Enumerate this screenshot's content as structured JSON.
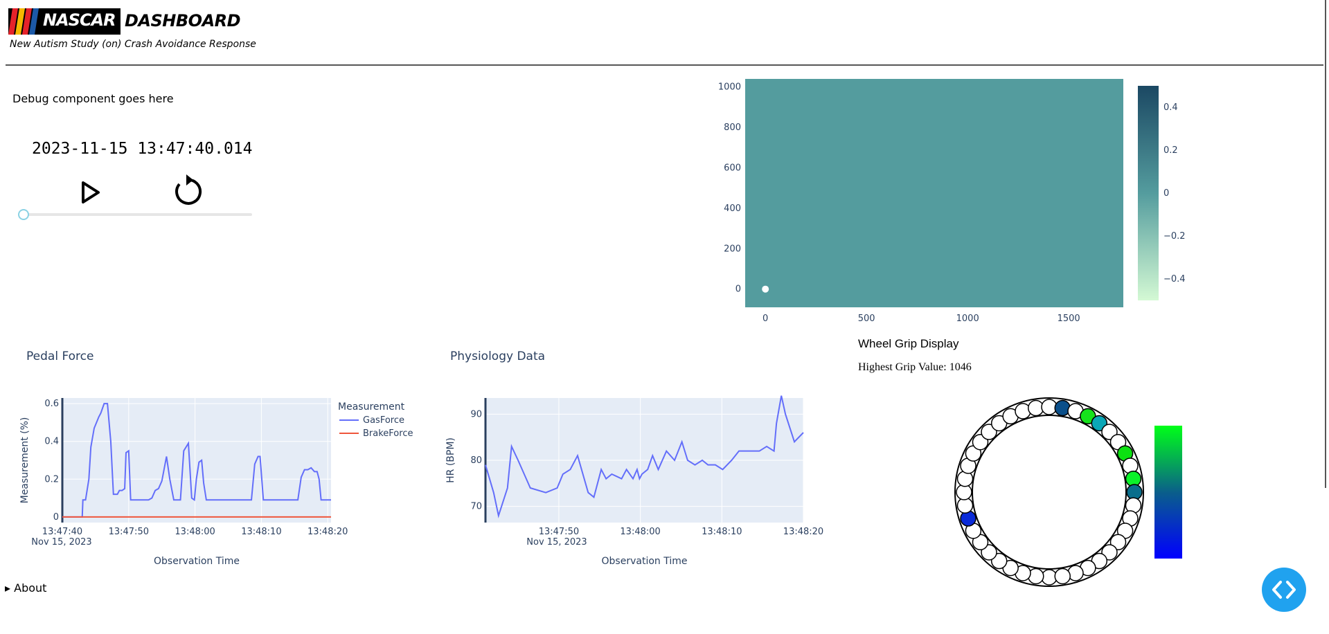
{
  "header": {
    "logo_text": "NASCAR",
    "title": "DASHBOARD",
    "subtitle": "New Autism Study (on) Crash Avoidance Response"
  },
  "debug": {
    "text": "Debug component goes here",
    "timestamp": "2023-11-15 13:47:40.014",
    "play_icon": "play-icon",
    "reset_icon": "reset-icon",
    "slider_value": 0
  },
  "colors": {
    "heatmap_fill": "#549c9e",
    "colorscale_top": "#1b4863",
    "colorscale_bottom": "#d4f9d4",
    "gas": "#636efa",
    "brake": "#ef553b",
    "plot_bg": "#e5ecf6",
    "accent": "#20a2ef"
  },
  "heatmap": {
    "chart_data": {
      "type": "heatmap",
      "x_ticks": [
        "0",
        "500",
        "1000",
        "1500"
      ],
      "y_ticks": [
        "0",
        "200",
        "400",
        "600",
        "800",
        "1000"
      ],
      "xlim": [
        -100,
        1770
      ],
      "ylim": [
        -90,
        1040
      ],
      "fill_value": 0,
      "marker": {
        "x": 0,
        "y": 0
      },
      "colorbar_ticks": [
        "0.4",
        "0.2",
        "0",
        "−0.2",
        "−0.4"
      ],
      "colorbar_range": [
        -0.5,
        0.5
      ]
    }
  },
  "pedal": {
    "title": "Pedal Force",
    "chart_data": {
      "type": "line",
      "xlabel": "Observation Time",
      "ylabel": "Measurement (%)",
      "x_ticks": [
        "13:47:40",
        "13:47:50",
        "13:48:00",
        "13:48:10",
        "13:48:20"
      ],
      "date_label": "Nov 15, 2023",
      "y_ticks": [
        "0",
        "0.2",
        "0.4",
        "0.6"
      ],
      "xlim": [
        0,
        40.5
      ],
      "ylim": [
        -0.03,
        0.63
      ],
      "legend_title": "Measurement",
      "series": [
        {
          "name": "GasForce",
          "x": [
            0,
            3.0,
            3.1,
            3.5,
            4.0,
            4.3,
            4.8,
            5.5,
            5.8,
            6.3,
            6.8,
            7.3,
            7.7,
            8.0,
            8.3,
            8.6,
            9.0,
            9.4,
            9.6,
            10.0,
            10.3,
            10.6,
            10.9,
            11.3,
            13.0,
            13.5,
            14.0,
            14.5,
            15.0,
            15.7,
            16.2,
            16.8,
            17.3,
            17.8,
            18.3,
            19.0,
            19.5,
            19.9,
            20.2,
            20.6,
            21.0,
            21.3,
            21.7,
            23.0,
            28.5,
            29.0,
            29.5,
            29.8,
            30.3,
            35.5,
            36.0,
            36.5,
            37.0,
            37.5,
            38.0,
            38.4,
            38.7,
            39.0,
            40.5
          ],
          "values": [
            0,
            0,
            0.09,
            0.09,
            0.2,
            0.37,
            0.47,
            0.53,
            0.55,
            0.6,
            0.6,
            0.4,
            0.12,
            0.12,
            0.12,
            0.14,
            0.14,
            0.15,
            0.34,
            0.35,
            0.09,
            0.09,
            0.09,
            0.09,
            0.09,
            0.1,
            0.14,
            0.15,
            0.19,
            0.32,
            0.2,
            0.09,
            0.09,
            0.09,
            0.35,
            0.39,
            0.1,
            0.09,
            0.2,
            0.29,
            0.3,
            0.18,
            0.09,
            0.09,
            0.09,
            0.28,
            0.32,
            0.32,
            0.09,
            0.09,
            0.21,
            0.25,
            0.25,
            0.26,
            0.24,
            0.24,
            0.2,
            0.09,
            0.09
          ]
        },
        {
          "name": "BrakeForce",
          "x": [
            0,
            40.5
          ],
          "values": [
            0,
            0
          ]
        }
      ]
    }
  },
  "physio": {
    "title": "Physiology Data",
    "chart_data": {
      "type": "line",
      "xlabel": "Observation Time",
      "ylabel": "HR (BPM)",
      "x_ticks": [
        "13:47:50",
        "13:48:00",
        "13:48:10",
        "13:48:20"
      ],
      "date_label": "Nov 15, 2023",
      "y_ticks": [
        "70",
        "80",
        "90"
      ],
      "xlim": [
        41,
        80
      ],
      "ylim": [
        66.5,
        93.5
      ],
      "series": [
        {
          "name": "HR",
          "x": [
            41,
            42.0,
            42.6,
            43.7,
            44.2,
            45.0,
            46.5,
            48.4,
            49.8,
            50.5,
            51.4,
            52.3,
            53.6,
            54.3,
            55.2,
            55.8,
            56.5,
            57.7,
            58.3,
            59.1,
            59.6,
            59.9,
            60.2,
            60.9,
            61.5,
            62.2,
            63.2,
            64.2,
            65.1,
            65.8,
            66.7,
            67.6,
            68.3,
            68.4,
            69.2,
            70.1,
            71.2,
            72.1,
            73.0,
            73.7,
            74.6,
            75.5,
            76.4,
            76.7,
            77.3,
            77.8,
            78.9,
            80.0
          ],
          "values": [
            79,
            73,
            68,
            74,
            83,
            80,
            74,
            73,
            74,
            77,
            78,
            81,
            73,
            72,
            78,
            76,
            77,
            76,
            78,
            76,
            78,
            76,
            77,
            78,
            81,
            78,
            82,
            80,
            84,
            80,
            79,
            80,
            79,
            79,
            79,
            78,
            80,
            82,
            82,
            82,
            82,
            83,
            82,
            88,
            94,
            90,
            84,
            86
          ]
        }
      ]
    }
  },
  "grip": {
    "title": "Wheel Grip Display",
    "value_label": "Highest Grip Value: 1046",
    "circle_count": 40,
    "highlights": [
      {
        "index": 21,
        "color": "#0b4f8a"
      },
      {
        "index": 23,
        "color": "#16e21c"
      },
      {
        "index": 24,
        "color": "#0aa7b7"
      },
      {
        "index": 27,
        "color": "#0ce011"
      },
      {
        "index": 29,
        "color": "#0cf22a"
      },
      {
        "index": 30,
        "color": "#0a6e8c"
      },
      {
        "index": 8,
        "color": "#0a2bd8"
      }
    ],
    "colorbar_top": "#00ff18",
    "colorbar_mid": "#0a5f8a",
    "colorbar_bottom": "#0000ff"
  },
  "footer": {
    "about_label": "▸ About",
    "code_icon": "code-icon"
  }
}
